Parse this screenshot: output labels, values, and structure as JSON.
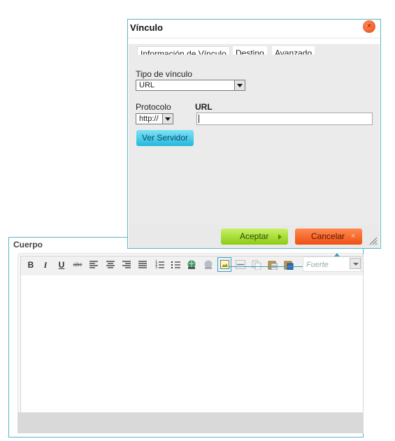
{
  "colors": {
    "frame_border": "#5bb6c8",
    "accept_green": "#8ccc14",
    "cancel_orange": "#ee5012",
    "server_cyan": "#25b8dc"
  },
  "cuerpo": {
    "title": "Cuerpo",
    "toolbar": {
      "bold": "B",
      "italic": "I",
      "underline": "U",
      "strike": "abc",
      "buttons": [
        "align-left-icon",
        "align-center-icon",
        "align-right-icon",
        "align-justify-icon",
        "numbered-list-icon",
        "bulleted-list-icon",
        "link-icon",
        "unlink-icon",
        "image-icon",
        "horizontal-rule-icon",
        "paste-icon",
        "paste-text-icon",
        "paste-word-icon"
      ],
      "format_value": "Fuerte"
    }
  },
  "dialog": {
    "title": "Vínculo",
    "close_symbol": "×",
    "tabs": [
      "Información de Vínculo",
      "Destino",
      "Avanzado"
    ],
    "link_type_label": "Tipo de vínculo",
    "link_type_value": "URL",
    "protocol_label": "Protocolo",
    "protocol_value": "http://",
    "url_label": "URL",
    "url_value": "",
    "browse_server_label": "Ver Servidor",
    "ok_label": "Aceptar",
    "cancel_label": "Cancelar",
    "cancel_symbol": "×"
  }
}
